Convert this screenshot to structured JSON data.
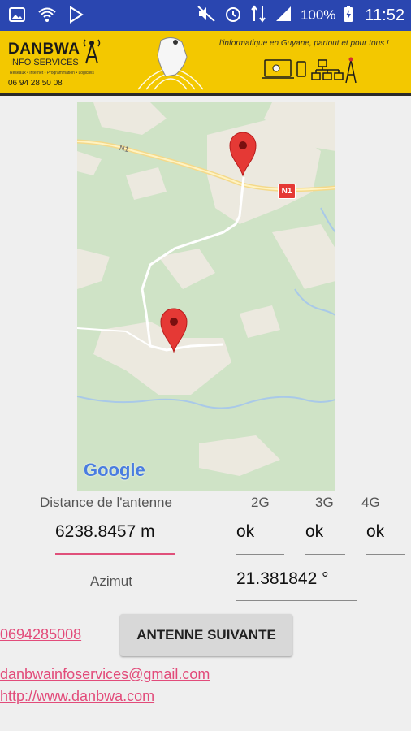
{
  "status_bar": {
    "battery": "100%",
    "time": "11:52"
  },
  "banner": {
    "brand": "DANBWA",
    "brand_sub": "INFO SERVICES",
    "brand_tiny": "Réseaux • Internet • Programmation • Logiciels",
    "phone": "06 94 28 50 08",
    "tagline": "l'informatique en Guyane, partout et pour tous !"
  },
  "map": {
    "road_label": "N1",
    "road_shield": "N1",
    "attribution": "Google",
    "markers": [
      "antenna-marker",
      "user-marker"
    ]
  },
  "info": {
    "distance_label": "Distance de l'antenne",
    "distance_value": "6238.8457 m",
    "azimut_label": "Azimut",
    "azimut_value": "21.381842 °",
    "net_headers": [
      "2G",
      "3G",
      "4G"
    ],
    "net_values": [
      "ok",
      "ok",
      "ok"
    ]
  },
  "actions": {
    "phone_link": "0694285008",
    "next_button": "ANTENNE SUIVANTE",
    "email_link": "danbwainfoservices@gmail.com",
    "web_link": "http://www.danbwa.com"
  },
  "colors": {
    "status_bar": "#2a46b0",
    "banner": "#f3c800",
    "link": "#e24b7a",
    "accent_underline": "#e0507a",
    "marker": "#e53935"
  }
}
